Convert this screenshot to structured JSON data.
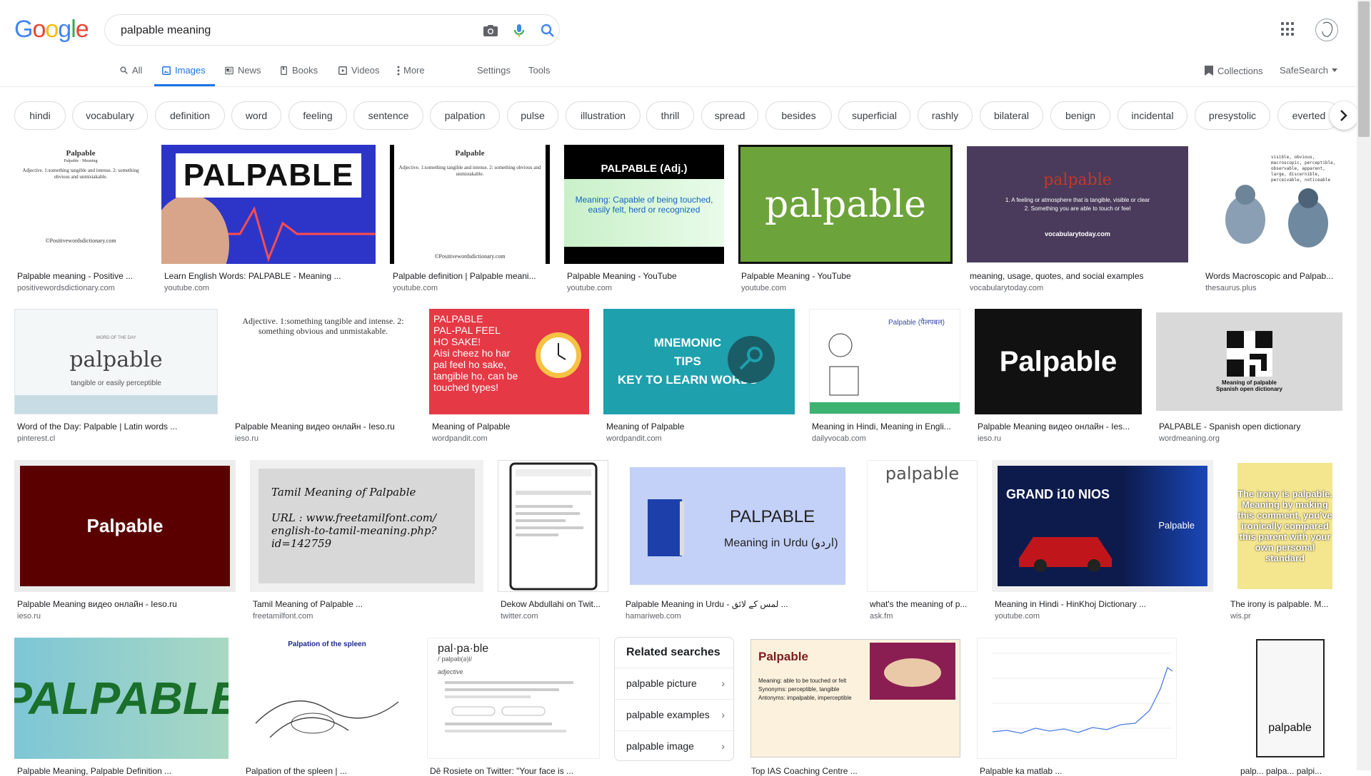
{
  "logo": "Google",
  "search": {
    "value": "palpable meaning"
  },
  "tabs": [
    {
      "label": "All",
      "icon": "search-icon"
    },
    {
      "label": "Images",
      "icon": "image-icon"
    },
    {
      "label": "News",
      "icon": "news-icon"
    },
    {
      "label": "Books",
      "icon": "book-icon"
    },
    {
      "label": "Videos",
      "icon": "video-icon"
    },
    {
      "label": "More",
      "icon": "more-vert-icon"
    }
  ],
  "tools": {
    "settings": "Settings",
    "tools": "Tools",
    "collections": "Collections",
    "safesearch": "SafeSearch"
  },
  "chips": [
    "hindi",
    "vocabulary",
    "definition",
    "word",
    "feeling",
    "sentence",
    "palpation",
    "pulse",
    "illustration",
    "thrill",
    "spread",
    "besides",
    "superficial",
    "rashly",
    "bilateral",
    "benign",
    "incidental",
    "presystolic",
    "everted"
  ],
  "results": {
    "row1": [
      {
        "title": "Palpable meaning - Positive ...",
        "source": "positivewordsdictionary.com"
      },
      {
        "title": "Learn English Words: PALPABLE - Meaning ...",
        "source": "youtube.com"
      },
      {
        "title": "Palpable definition | Palpable meani...",
        "source": "youtube.com"
      },
      {
        "title": "Palpable Meaning - YouTube",
        "source": "youtube.com"
      },
      {
        "title": "Palpable Meaning - YouTube",
        "source": "youtube.com"
      },
      {
        "title": "meaning, usage, quotes, and social examples",
        "source": "vocabularytoday.com"
      },
      {
        "title": "Words Macroscopic and Palpab...",
        "source": "thesaurus.plus"
      }
    ],
    "row2": [
      {
        "title": "Word of the Day: Palpable | Latin words ...",
        "source": "pinterest.cl"
      },
      {
        "title": "Palpable Meaning видео онлайн - Ieso.ru",
        "source": "ieso.ru"
      },
      {
        "title": "Meaning of Palpable",
        "source": "wordpandit.com"
      },
      {
        "title": "Meaning of Palpable",
        "source": "wordpandit.com"
      },
      {
        "title": "Meaning in Hindi, Meaning in Engli...",
        "source": "dailyvocab.com"
      },
      {
        "title": "Palpable Meaning видео онлайн - Ies...",
        "source": "ieso.ru"
      },
      {
        "title": "PALPABLE - Spanish open dictionary",
        "source": "wordmeaning.org"
      }
    ],
    "row3": [
      {
        "title": "Palpable Meaning видео онлайн - Ieso.ru",
        "source": "ieso.ru"
      },
      {
        "title": "Tamil Meaning of Palpable ...",
        "source": "freetamilfont.com"
      },
      {
        "title": "Dekow Abdullahi on Twit...",
        "source": "twitter.com"
      },
      {
        "title": "Palpable Meaning in Urdu - لمس کے لائق ...",
        "source": "hamariweb.com"
      },
      {
        "title": "what's the meaning of p...",
        "source": "ask.fm"
      },
      {
        "title": "Meaning in Hindi - HinKhoj Dictionary ...",
        "source": "youtube.com"
      },
      {
        "title": "The irony is palpable. M...",
        "source": "wis.pr"
      }
    ],
    "row4": [
      {
        "title": "Palpable Meaning, Palpable Definition ...",
        "source": ""
      },
      {
        "title": "Palpation of the spleen | ...",
        "source": ""
      },
      {
        "title": "Dê Rosiete on Twitter: \"Your face is ...",
        "source": ""
      },
      {
        "title": "Top IAS Coaching Centre ...",
        "source": ""
      },
      {
        "title": "Palpable ka matlab ...",
        "source": ""
      },
      {
        "title": "palp... palpa... palpi...",
        "source": ""
      }
    ]
  },
  "related": {
    "heading": "Related searches",
    "items": [
      "palpable picture",
      "palpable examples",
      "palpable image"
    ]
  },
  "thumb_text": {
    "t1_title": "Palpable",
    "t1_sub": "Palpable · Meaning",
    "t1_def": "Adjective. 1:something tangible and intense. 2: something obvious and unmistakable.",
    "t1_foot": "©Positivewordsdictionary.com",
    "t2": "PALPABLE",
    "t4_head": "PALPABLE (Adj.)",
    "t4_def": "Meaning: Capable of being touched, easily felt, herd or recognized",
    "t5": "palpable",
    "t6_word": "palpable",
    "t6_def": "1. A feeling or atmosphere that is tangible, visible or clear\n2. Something you are able to touch or feel",
    "t6_src": "vocabularytoday.com",
    "t7": "visible, obvious, macroscopic, perceptible, observable, apparent, large, discernible, perceivable, noticeable",
    "t8_top": "WORD OF THE DAY",
    "t8_word": "palpable",
    "t8_def": "tangible or easily perceptible",
    "t9": "Adjective. 1:something tangible and intense. 2: something obvious and unmistakable.",
    "t10": "PALPABLE\nPAL-PAL FEEL\nHO SAKE!\nAisi cheez ho har\npal feel ho sake,\ntangible ho, can be\ntouched types!",
    "t11": "MNEMONIC\nTIPS\nKEY TO LEARN WORDS",
    "t12": "Palpable (पैलपबल)",
    "t13": "Palpable",
    "t14": "Meaning of palpable\nSpanish open dictionary",
    "t15": "Palpable",
    "t16": "Tamil Meaning of Palpable\n\nURL : www.freetamilfont.com/\nenglish-to-tamil-meaning.php?id=142759",
    "t18_a": "PALPABLE",
    "t18_b": "Meaning in Urdu (اردو)",
    "t19": "palpable",
    "t20_a": "GRAND i10 NIOS",
    "t20_b": "Palpable",
    "t21": "The irony is palpable. Meaning by making this comment, you've ironically compared this parent with your own personal standard",
    "t22": "PALPABLE",
    "t23": "Palpation of the spleen",
    "t24_a": "pal·pa·ble",
    "t24_b": "/ˈpalpəb(ə)l/",
    "t24_c": "adjective",
    "t25_a": "Palpable",
    "t25_b": "Meaning: able to be touched or felt\nSynonyms: perceptible, tangible\nAntonyms: impalpable, imperceptible",
    "t27": "palpable"
  }
}
